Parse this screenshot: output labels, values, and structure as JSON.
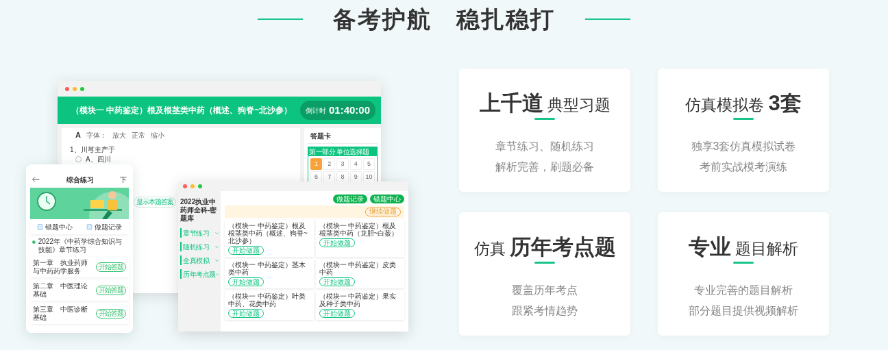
{
  "heading": {
    "title": "备考护航　稳扎稳打"
  },
  "features": [
    {
      "parts": [
        {
          "text": "上千道",
          "emphasis": true
        },
        {
          "text": "典型习题",
          "emphasis": false
        }
      ],
      "lines": [
        "章节练习、随机练习",
        "解析完善，刷题必备"
      ]
    },
    {
      "parts": [
        {
          "text": "仿真模拟卷",
          "emphasis": false
        },
        {
          "text": "3套",
          "emphasis": true
        }
      ],
      "lines": [
        "独享3套仿真模拟试卷",
        "考前实战模考演练"
      ]
    },
    {
      "parts": [
        {
          "text": "仿真",
          "emphasis": false
        },
        {
          "text": "历年考点题",
          "emphasis": true
        }
      ],
      "lines": [
        "覆盖历年考点",
        "跟紧考情趋势"
      ]
    },
    {
      "parts": [
        {
          "text": "专业",
          "emphasis": true
        },
        {
          "text": "题目解析",
          "emphasis": false
        }
      ],
      "lines": [
        "专业完善的题目解析",
        "部分题目提供视频解析"
      ]
    }
  ],
  "exam_window": {
    "title": "（模块一 中药鉴定）根及根茎类中药（概述、狗脊~北沙参）",
    "timer_label": "倒计时",
    "timer": "01:40:00",
    "font_icon": "A",
    "font_label": "字体：",
    "font_options": [
      "放大",
      "正常",
      "缩小"
    ],
    "question": "1、川芎主产于",
    "options": [
      {
        "label": "A、四川",
        "selected": false
      }
    ],
    "show_answer": "显示本题答案",
    "card_title": "答题卡",
    "section": "第一部分 单位选择题",
    "numbers": [
      {
        "label": "1",
        "current": true
      },
      {
        "label": "2",
        "current": false
      },
      {
        "label": "3",
        "current": false
      },
      {
        "label": "4",
        "current": false
      },
      {
        "label": "5",
        "current": false
      },
      {
        "label": "6",
        "current": false
      },
      {
        "label": "7",
        "current": false
      },
      {
        "label": "8",
        "current": false
      },
      {
        "label": "9",
        "current": false
      },
      {
        "label": "10",
        "current": false
      }
    ]
  },
  "phone": {
    "title": "综合练习",
    "action": "下",
    "shortcuts": [
      "错题中心",
      "做题记录"
    ],
    "subject": "2022年《中药学综合知识与技能》章节练习",
    "chapters": [
      {
        "name": "第一章　执业药师与中药药学服务",
        "button": "开始答题"
      },
      {
        "name": "第二章　中医理论基础",
        "button": "开始答题"
      },
      {
        "name": "第三章　中医诊断基础",
        "button": "开始答题"
      }
    ]
  },
  "bank_window": {
    "title": "2022执业中药师全科-密题库",
    "menu": [
      "章节练习",
      "随机练习",
      "全真模拟",
      "历年考点题"
    ],
    "actions": [
      "做题记录",
      "错题中心"
    ],
    "continue": "继续做题",
    "cards": [
      {
        "title": "（模块一 中药鉴定）根及根茎类中药（概述、狗脊~北沙参）",
        "button": "开始做题"
      },
      {
        "title": "（模块一 中药鉴定）根及根茎类中药（龙胆~白蔹）",
        "button": "开始做题"
      },
      {
        "title": "（模块一 中药鉴定）茎木类中药",
        "button": "开始做题"
      },
      {
        "title": "（模块一 中药鉴定）皮类中药",
        "button": "开始做题"
      },
      {
        "title": "（模块一 中药鉴定）叶类中药、花类中药",
        "button": "开始做题"
      },
      {
        "title": "（模块一 中药鉴定）果实及种子类中药",
        "button": "开始做题"
      }
    ]
  }
}
